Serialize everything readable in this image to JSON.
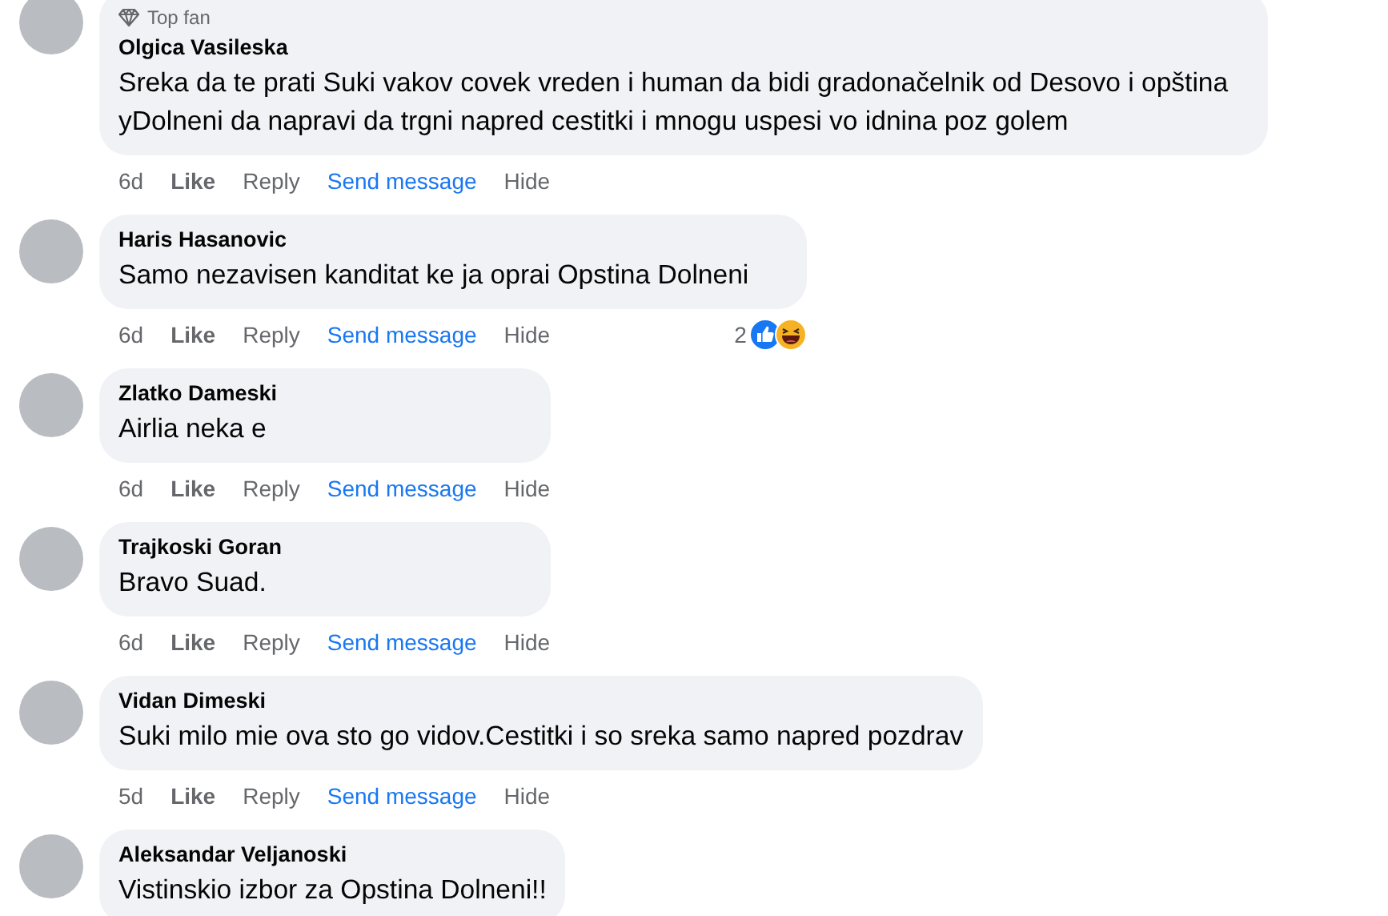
{
  "comments": [
    {
      "badge": "Top fan",
      "author": "Olgica Vasileska",
      "text": "Sreka da te prati Suki vakov covek vreden i human da bidi gradonačelnik od Desovo i opština yDolneni da napravi da trgni napred cestitki i mnogu uspesi vo idnina poz golem",
      "time": "6d",
      "actions": [
        "Like",
        "Reply",
        "Send message",
        "Hide"
      ]
    },
    {
      "author": "Haris Hasanovic",
      "text": "Samo nezavisen kanditat ke ja oprai Opstina Dolneni",
      "time": "6d",
      "actions": [
        "Like",
        "Reply",
        "Send message",
        "Hide"
      ],
      "reaction_count": "2"
    },
    {
      "author": "Zlatko Dameski",
      "text": "Airlia neka e",
      "time": "6d",
      "actions": [
        "Like",
        "Reply",
        "Send message",
        "Hide"
      ]
    },
    {
      "author": "Trajkoski Goran",
      "text": "Bravo Suad.",
      "time": "6d",
      "actions": [
        "Like",
        "Reply",
        "Send message",
        "Hide"
      ]
    },
    {
      "author": "Vidan Dimeski",
      "text": "Suki milo mie ova sto go vidov.Cestitki i so sreka samo napred pozdrav",
      "time": "5d",
      "actions": [
        "Like",
        "Reply",
        "Send message",
        "Hide"
      ]
    },
    {
      "author": "Aleksandar Veljanoski",
      "text": "Vistinskio izbor za Opstina Dolneni!!"
    }
  ]
}
